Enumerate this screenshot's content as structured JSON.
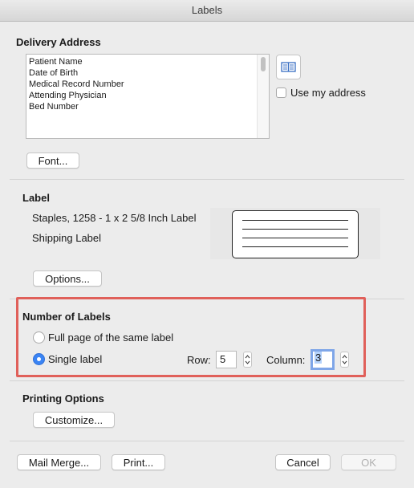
{
  "window": {
    "title": "Labels"
  },
  "delivery": {
    "heading": "Delivery Address",
    "lines": [
      "Patient Name",
      "Date of Birth",
      "Medical Record Number",
      "Attending Physician",
      "Bed Number"
    ],
    "use_my_address_label": "Use my address",
    "font_button": "Font..."
  },
  "label": {
    "heading": "Label",
    "product": "Staples, 1258 - 1 x 2 5/8 Inch Label",
    "type": "Shipping Label",
    "options_button": "Options..."
  },
  "number_of_labels": {
    "heading": "Number of Labels",
    "full_page_label": "Full page of the same label",
    "single_label": "Single label",
    "row_label": "Row:",
    "row_value": "5",
    "column_label": "Column:",
    "column_value": "3"
  },
  "printing": {
    "heading": "Printing Options",
    "customize_button": "Customize..."
  },
  "footer": {
    "mail_merge": "Mail Merge...",
    "print": "Print...",
    "cancel": "Cancel",
    "ok": "OK"
  },
  "colors": {
    "accent": "#3a84f4",
    "highlight": "#e0605a"
  }
}
